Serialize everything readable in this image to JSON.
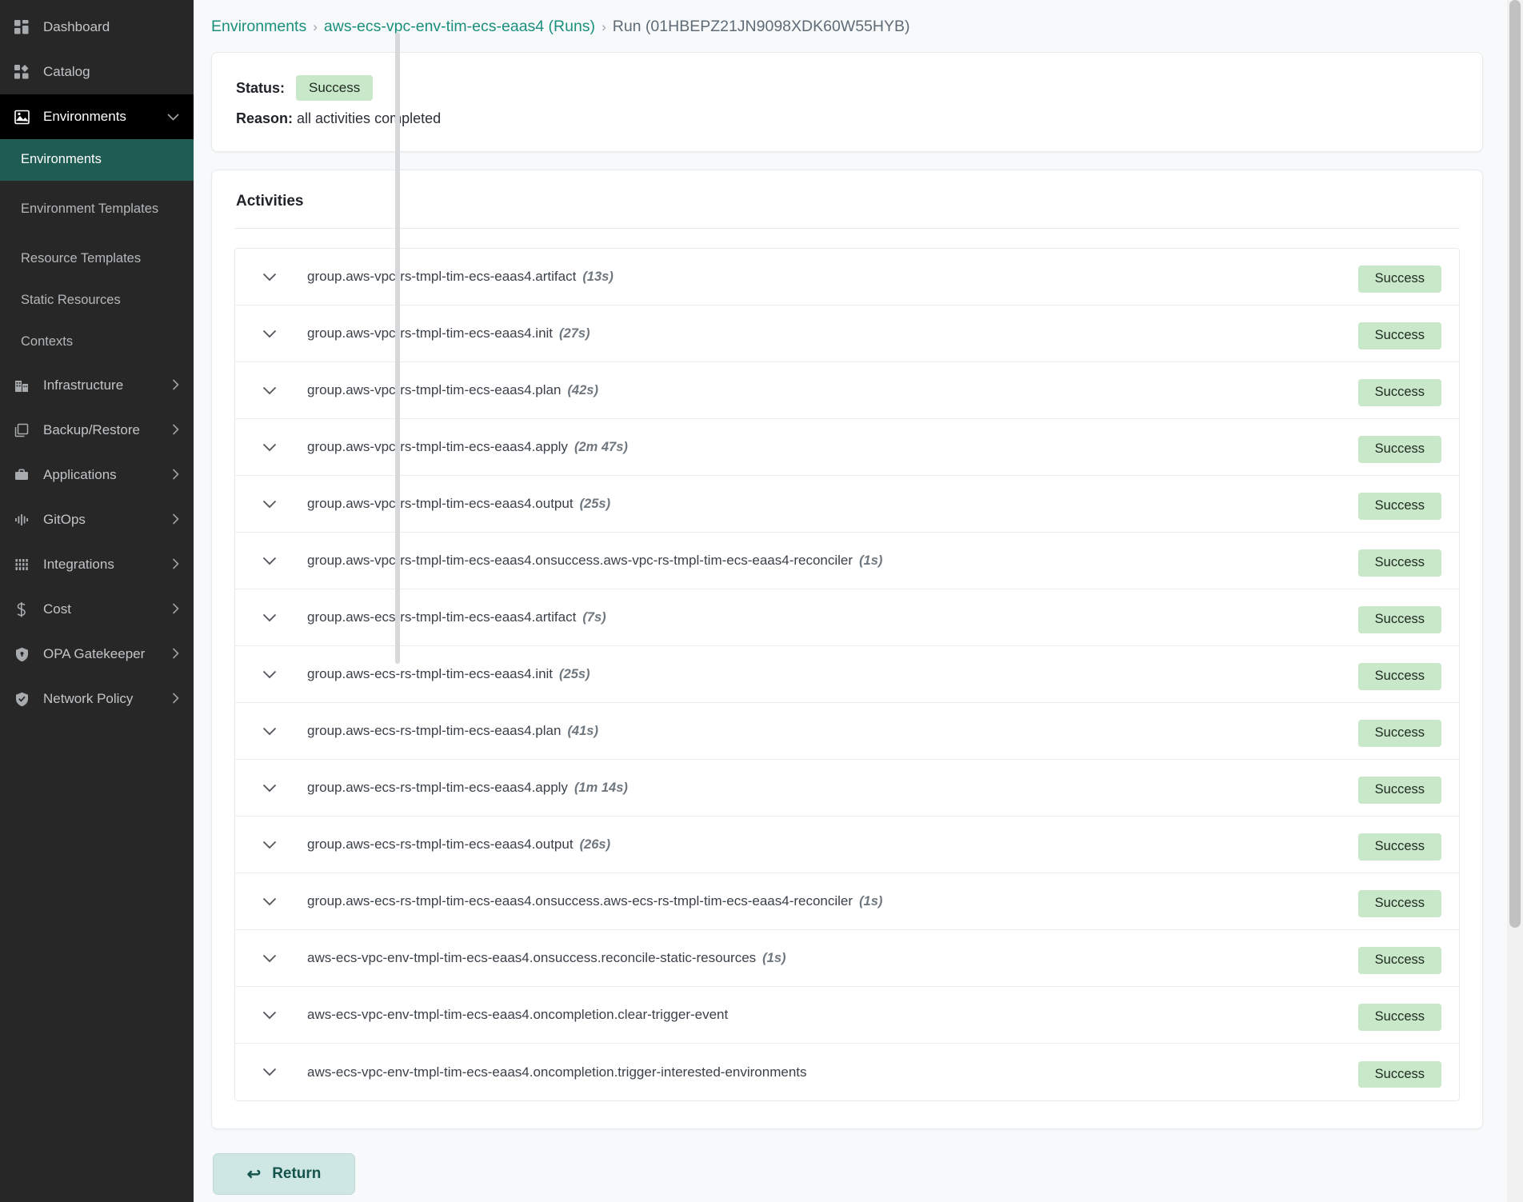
{
  "sidebar": {
    "items": [
      {
        "label": "Dashboard",
        "icon": "grid-dashboard-icon",
        "expandable": false,
        "state": "normal"
      },
      {
        "label": "Catalog",
        "icon": "catalog-blocks-icon",
        "expandable": false,
        "state": "normal"
      },
      {
        "label": "Environments",
        "icon": "environments-image-icon",
        "expandable": true,
        "state": "expanded",
        "chevron": "chevron-down"
      }
    ],
    "sub_items": [
      {
        "label": "Environments",
        "active": true
      },
      {
        "label": "Environment Templates",
        "active": false
      },
      {
        "label": "Resource Templates",
        "active": false
      },
      {
        "label": "Static Resources",
        "active": false
      },
      {
        "label": "Contexts",
        "active": false
      }
    ],
    "items_after": [
      {
        "label": "Infrastructure",
        "icon": "building-icon",
        "chevron": "chevron-right"
      },
      {
        "label": "Backup/Restore",
        "icon": "copy-icon",
        "chevron": "chevron-right"
      },
      {
        "label": "Applications",
        "icon": "briefcase-icon",
        "chevron": "chevron-right"
      },
      {
        "label": "GitOps",
        "icon": "gitops-waveform-icon",
        "chevron": "chevron-right"
      },
      {
        "label": "Integrations",
        "icon": "integrations-sliders-icon",
        "chevron": "chevron-right"
      },
      {
        "label": "Cost",
        "icon": "dollar-icon",
        "chevron": "chevron-right"
      },
      {
        "label": "OPA Gatekeeper",
        "icon": "shield-icon",
        "chevron": "chevron-right"
      },
      {
        "label": "Network Policy",
        "icon": "shield-check-icon",
        "chevron": "chevron-right"
      }
    ]
  },
  "breadcrumb": {
    "root": "Environments",
    "separator": "›",
    "environment": "aws-ecs-vpc-env-tim-ecs-eaas4 (Runs)",
    "current": "Run (01HBEPZ21JN9098XDK60W55HYB)"
  },
  "status_card": {
    "status_label": "Status:",
    "status_value": "Success",
    "reason_label": "Reason:",
    "reason_value": "all activities completed"
  },
  "activities": {
    "title": "Activities",
    "rows": [
      {
        "name": "group.aws-vpc-rs-tmpl-tim-ecs-eaas4.artifact",
        "duration": "(13s)",
        "status": "Success"
      },
      {
        "name": "group.aws-vpc-rs-tmpl-tim-ecs-eaas4.init",
        "duration": "(27s)",
        "status": "Success"
      },
      {
        "name": "group.aws-vpc-rs-tmpl-tim-ecs-eaas4.plan",
        "duration": "(42s)",
        "status": "Success"
      },
      {
        "name": "group.aws-vpc-rs-tmpl-tim-ecs-eaas4.apply",
        "duration": "(2m 47s)",
        "status": "Success"
      },
      {
        "name": "group.aws-vpc-rs-tmpl-tim-ecs-eaas4.output",
        "duration": "(25s)",
        "status": "Success"
      },
      {
        "name": "group.aws-vpc-rs-tmpl-tim-ecs-eaas4.onsuccess.aws-vpc-rs-tmpl-tim-ecs-eaas4-reconciler",
        "duration": "(1s)",
        "status": "Success"
      },
      {
        "name": "group.aws-ecs-rs-tmpl-tim-ecs-eaas4.artifact",
        "duration": "(7s)",
        "status": "Success"
      },
      {
        "name": "group.aws-ecs-rs-tmpl-tim-ecs-eaas4.init",
        "duration": "(25s)",
        "status": "Success"
      },
      {
        "name": "group.aws-ecs-rs-tmpl-tim-ecs-eaas4.plan",
        "duration": "(41s)",
        "status": "Success"
      },
      {
        "name": "group.aws-ecs-rs-tmpl-tim-ecs-eaas4.apply",
        "duration": "(1m 14s)",
        "status": "Success"
      },
      {
        "name": "group.aws-ecs-rs-tmpl-tim-ecs-eaas4.output",
        "duration": "(26s)",
        "status": "Success"
      },
      {
        "name": "group.aws-ecs-rs-tmpl-tim-ecs-eaas4.onsuccess.aws-ecs-rs-tmpl-tim-ecs-eaas4-reconciler",
        "duration": "(1s)",
        "status": "Success"
      },
      {
        "name": "aws-ecs-vpc-env-tmpl-tim-ecs-eaas4.onsuccess.reconcile-static-resources",
        "duration": "(1s)",
        "status": "Success"
      },
      {
        "name": "aws-ecs-vpc-env-tmpl-tim-ecs-eaas4.oncompletion.clear-trigger-event",
        "duration": "",
        "status": "Success"
      },
      {
        "name": "aws-ecs-vpc-env-tmpl-tim-ecs-eaas4.oncompletion.trigger-interested-environments",
        "duration": "",
        "status": "Success"
      }
    ]
  },
  "footer": {
    "return_label": "Return",
    "return_arrow": "↩"
  },
  "colors": {
    "sidebar_bg": "#272727",
    "sidebar_active": "#1f5c54",
    "accent_teal": "#1a8f7e",
    "badge_green_bg": "#c9e7c9",
    "return_bg": "#cfe7e4",
    "return_text": "#15544c"
  }
}
